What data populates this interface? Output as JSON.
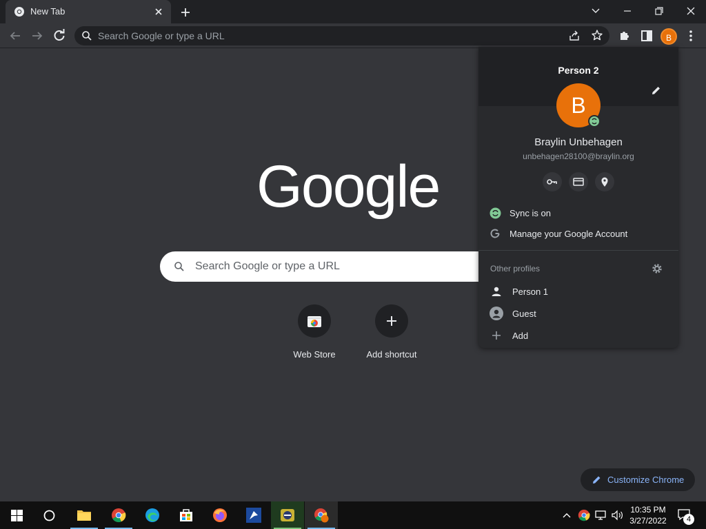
{
  "tab": {
    "title": "New Tab"
  },
  "omnibox": {
    "placeholder": "Search Google or type a URL"
  },
  "avatar_letter": "B",
  "ntp": {
    "logo": "Google",
    "search_placeholder": "Search Google or type a URL",
    "shortcuts": [
      {
        "label": "Web Store"
      },
      {
        "label": "Add shortcut"
      }
    ],
    "customize_label": "Customize Chrome"
  },
  "profile_menu": {
    "profile_name": "Person 2",
    "avatar_letter": "B",
    "user_name": "Braylin Unbehagen",
    "email": "unbehagen28100@braylin.org",
    "sync_label": "Sync is on",
    "manage_label": "Manage your Google Account",
    "other_profiles_label": "Other profiles",
    "profiles": [
      {
        "label": "Person 1"
      },
      {
        "label": "Guest"
      },
      {
        "label": "Add"
      }
    ]
  },
  "taskbar": {
    "time": "10:35 PM",
    "date": "3/27/2022",
    "notification_count": "4"
  },
  "colors": {
    "accent_orange": "#e8710a",
    "sync_green": "#81c995",
    "link_blue": "#8ab4f8",
    "background": "#35363a"
  }
}
